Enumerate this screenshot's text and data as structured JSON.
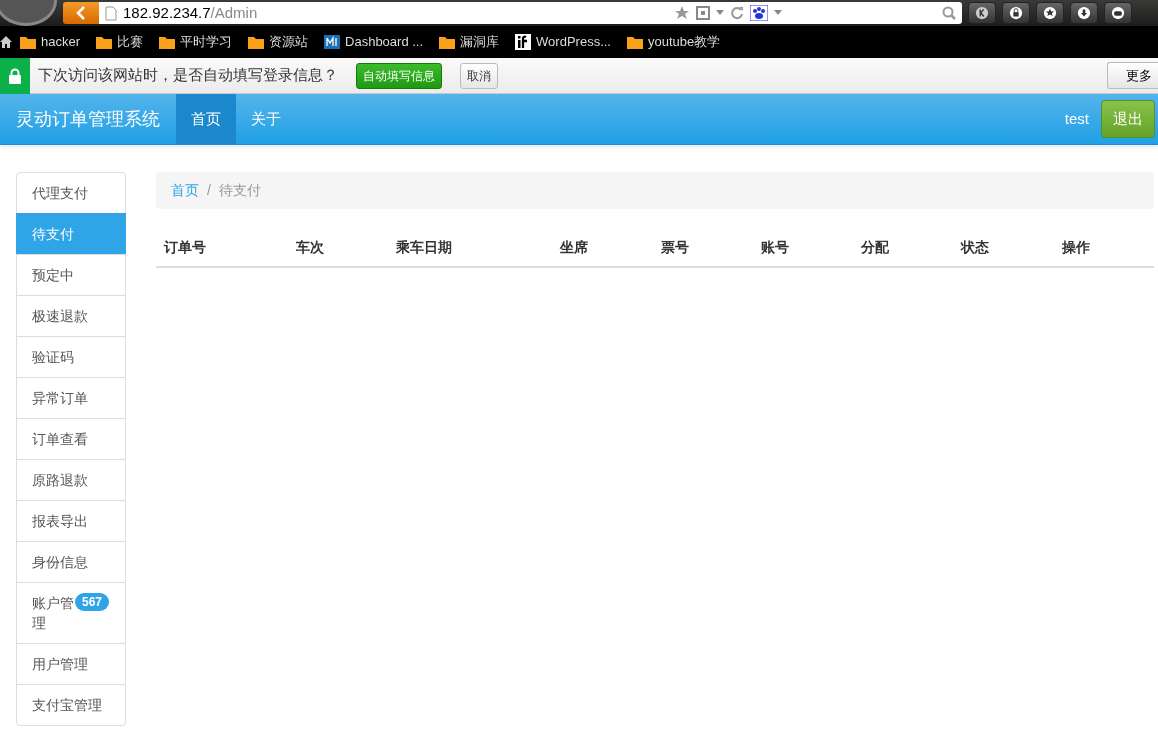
{
  "browser": {
    "url": {
      "host": "182.92.234.7",
      "path": "/Admin"
    },
    "bookmarks": [
      {
        "label": "hacker",
        "kind": "folder"
      },
      {
        "label": "比赛",
        "kind": "folder"
      },
      {
        "label": "平时学习",
        "kind": "folder"
      },
      {
        "label": "资源站",
        "kind": "folder"
      },
      {
        "label": "Dashboard ...",
        "kind": "site"
      },
      {
        "label": "漏洞库",
        "kind": "folder"
      },
      {
        "label": "WordPress...",
        "kind": "wp"
      },
      {
        "label": "youtube教学",
        "kind": "folder"
      }
    ],
    "password_bar": {
      "message": "下次访问该网站时，是否自动填写登录信息？",
      "buttons": [
        {
          "label": "自动填写信息",
          "kind": "primary"
        },
        {
          "label": "取消",
          "kind": "plain"
        }
      ],
      "more": "更多"
    }
  },
  "navbar": {
    "brand": "灵动订单管理系统",
    "links": [
      {
        "label": "首页",
        "selected": true
      },
      {
        "label": "关于",
        "selected": false
      }
    ],
    "user": "test",
    "logout": "退出"
  },
  "sidebar": {
    "items": [
      {
        "label": "代理支付",
        "selected": false
      },
      {
        "label": "待支付",
        "selected": true
      },
      {
        "label": "预定中",
        "selected": false
      },
      {
        "label": "极速退款",
        "selected": false
      },
      {
        "label": "验证码",
        "selected": false
      },
      {
        "label": "异常订单",
        "selected": false
      },
      {
        "label": "订单查看",
        "selected": false
      },
      {
        "label": "原路退款",
        "selected": false
      },
      {
        "label": "报表导出",
        "selected": false
      },
      {
        "label": "身份信息",
        "selected": false
      },
      {
        "label": "账户管理",
        "selected": false,
        "badge": "567"
      },
      {
        "label": "用户管理",
        "selected": false
      },
      {
        "label": "支付宝管理",
        "selected": false
      }
    ]
  },
  "breadcrumb": {
    "separator": "/",
    "items": [
      {
        "label": "首页",
        "kind": "link"
      },
      {
        "label": "待支付",
        "kind": "current"
      }
    ]
  },
  "table": {
    "columns": [
      "订单号",
      "车次",
      "乘车日期",
      "坐席",
      "票号",
      "账号",
      "分配",
      "状态",
      "操作"
    ]
  }
}
